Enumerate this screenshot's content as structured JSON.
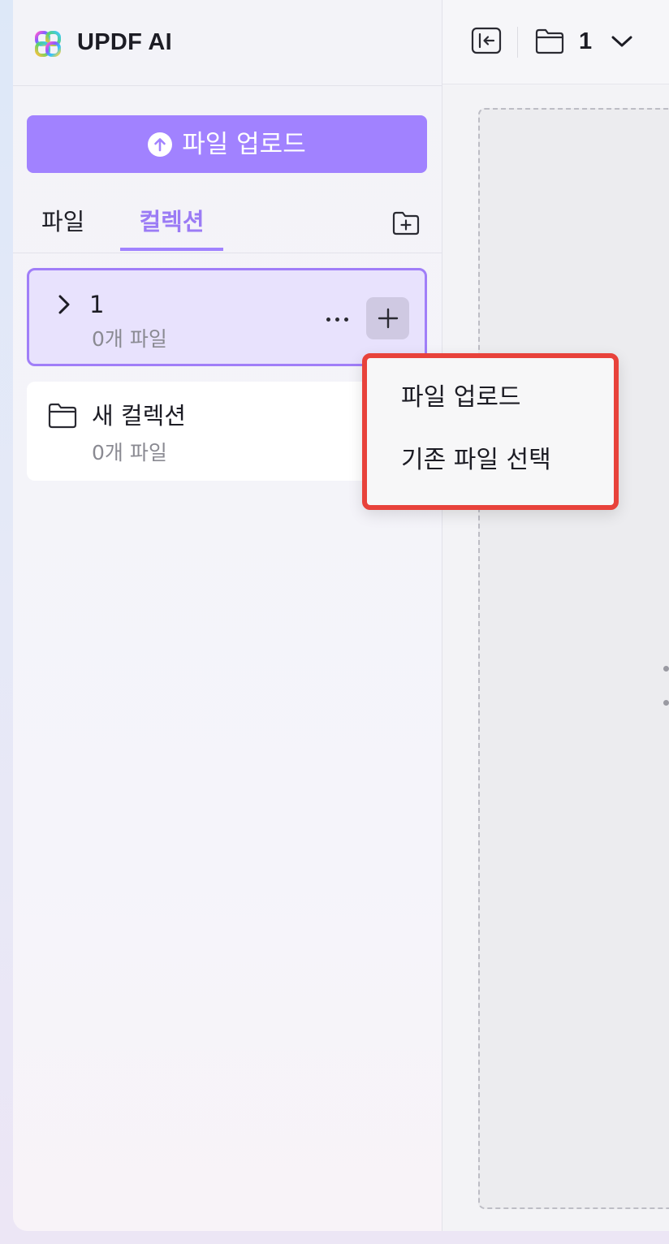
{
  "brand": {
    "name": "UPDF AI"
  },
  "sidebar": {
    "upload_button": "파일 업로드",
    "tabs": [
      {
        "label": "파일"
      },
      {
        "label": "컬렉션"
      }
    ],
    "collections": [
      {
        "title": "1",
        "file_count": "0개 파일"
      },
      {
        "title": "새 컬렉션",
        "file_count": "0개 파일"
      }
    ]
  },
  "topbar": {
    "current_collection": "1"
  },
  "popup_menu": {
    "items": [
      {
        "label": "파일 업로드"
      },
      {
        "label": "기존 파일 선택"
      }
    ]
  },
  "colors": {
    "accent": "#a182ff",
    "active_card_bg": "#e8e2fd",
    "highlight_border": "#e8423b"
  }
}
